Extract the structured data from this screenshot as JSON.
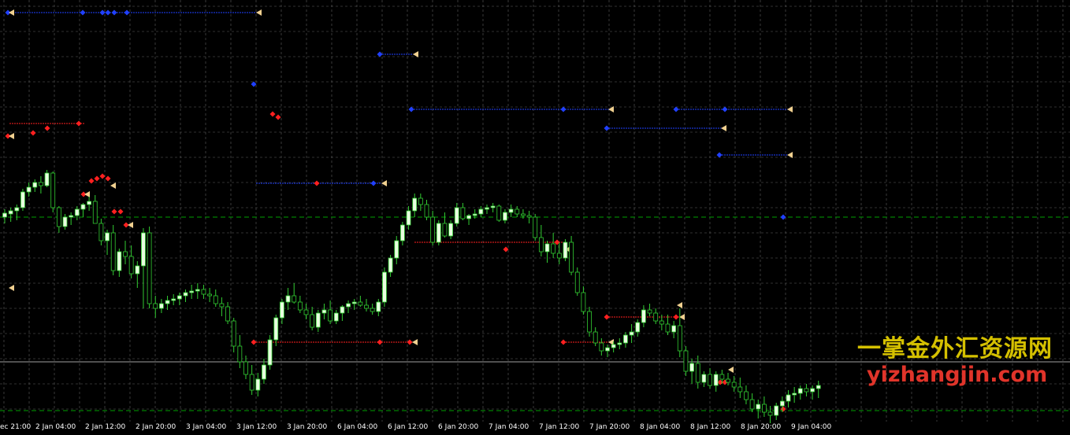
{
  "chart_data": {
    "type": "candlestick",
    "title": "",
    "xlabel": "",
    "ylabel": "",
    "grid": true,
    "background": "#000000",
    "colors": {
      "grid": "#606060",
      "bull_body": "#e8ffe0",
      "bear_body": "#000000",
      "wick": "#32cd32",
      "level_line": "#00a000",
      "blue_marker": "#2040ff",
      "red_marker": "#ff2020",
      "tan_marker": "#f0d090",
      "bid_line": "#a0a0a0"
    },
    "time_labels": [
      "ec 21:00",
      "2 Jan 04:00",
      "2 Jan 12:00",
      "2 Jan 20:00",
      "3 Jan 04:00",
      "3 Jan 12:00",
      "3 Jan 20:00",
      "6 Jan 04:00",
      "6 Jan 12:00",
      "6 Jan 20:00",
      "7 Jan 04:00",
      "7 Jan 12:00",
      "7 Jan 20:00",
      "8 Jan 04:00",
      "8 Jan 12:00",
      "8 Jan 20:00",
      "9 Jan 04:00"
    ],
    "candles": [
      [
        0,
        0,
        10,
        -8,
        5
      ],
      [
        1,
        4,
        12,
        -6,
        8
      ],
      [
        2,
        8,
        16,
        -4,
        12
      ],
      [
        3,
        12,
        36,
        8,
        32
      ],
      [
        4,
        32,
        44,
        26,
        38
      ],
      [
        5,
        38,
        48,
        32,
        44
      ],
      [
        6,
        44,
        52,
        30,
        40
      ],
      [
        7,
        40,
        60,
        38,
        56
      ],
      [
        8,
        56,
        58,
        6,
        12
      ],
      [
        9,
        12,
        14,
        -20,
        -12
      ],
      [
        10,
        -12,
        4,
        -16,
        0
      ],
      [
        11,
        0,
        6,
        -10,
        2
      ],
      [
        12,
        2,
        14,
        -4,
        10
      ],
      [
        13,
        10,
        18,
        0,
        16
      ],
      [
        14,
        16,
        26,
        8,
        20
      ],
      [
        15,
        20,
        28,
        -4,
        -8
      ],
      [
        16,
        -8,
        -2,
        -36,
        -30
      ],
      [
        17,
        -30,
        -16,
        -48,
        -20
      ],
      [
        18,
        -20,
        -10,
        -74,
        -68
      ],
      [
        19,
        -68,
        -40,
        -76,
        -44
      ],
      [
        20,
        -44,
        -30,
        -60,
        -50
      ],
      [
        21,
        -50,
        -36,
        -78,
        -72
      ],
      [
        22,
        -72,
        -56,
        -90,
        -62
      ],
      [
        23,
        -62,
        -14,
        -116,
        -20
      ],
      [
        24,
        -20,
        -12,
        -116,
        -110
      ],
      [
        25,
        -110,
        -100,
        -128,
        -116
      ],
      [
        26,
        -116,
        -104,
        -122,
        -110
      ],
      [
        27,
        -110,
        -100,
        -118,
        -106
      ],
      [
        28,
        -106,
        -98,
        -112,
        -104
      ],
      [
        29,
        -104,
        -96,
        -112,
        -100
      ],
      [
        30,
        -100,
        -92,
        -108,
        -96
      ],
      [
        31,
        -96,
        -86,
        -104,
        -94
      ],
      [
        32,
        -94,
        -84,
        -104,
        -92
      ],
      [
        33,
        -92,
        -86,
        -104,
        -98
      ],
      [
        34,
        -98,
        -90,
        -108,
        -100
      ],
      [
        35,
        -100,
        -92,
        -114,
        -110
      ],
      [
        36,
        -110,
        -102,
        -126,
        -114
      ],
      [
        37,
        -114,
        -108,
        -136,
        -132
      ],
      [
        38,
        -132,
        -128,
        -172,
        -164
      ],
      [
        39,
        -164,
        -150,
        -192,
        -184
      ],
      [
        40,
        -184,
        -176,
        -206,
        -200
      ],
      [
        41,
        -200,
        -188,
        -226,
        -220
      ],
      [
        42,
        -220,
        -198,
        -228,
        -206
      ],
      [
        43,
        -206,
        -180,
        -212,
        -188
      ],
      [
        44,
        -188,
        -150,
        -194,
        -156
      ],
      [
        45,
        -156,
        -124,
        -164,
        -128
      ],
      [
        46,
        -128,
        -104,
        -136,
        -108
      ],
      [
        47,
        -108,
        -90,
        -118,
        -100
      ],
      [
        48,
        -100,
        -84,
        -110,
        -108
      ],
      [
        49,
        -108,
        -100,
        -122,
        -118
      ],
      [
        50,
        -118,
        -110,
        -130,
        -124
      ],
      [
        51,
        -124,
        -114,
        -144,
        -140
      ],
      [
        52,
        -140,
        -118,
        -146,
        -122
      ],
      [
        53,
        -122,
        -110,
        -130,
        -118
      ],
      [
        54,
        -118,
        -106,
        -136,
        -132
      ],
      [
        55,
        -132,
        -118,
        -136,
        -122
      ],
      [
        56,
        -122,
        -112,
        -132,
        -114
      ],
      [
        57,
        -114,
        -106,
        -122,
        -110
      ],
      [
        58,
        -110,
        -104,
        -118,
        -108
      ],
      [
        59,
        -108,
        -100,
        -114,
        -112
      ],
      [
        60,
        -112,
        -104,
        -120,
        -116
      ],
      [
        61,
        -116,
        -110,
        -124,
        -120
      ],
      [
        62,
        -120,
        -104,
        -126,
        -108
      ],
      [
        63,
        -108,
        -64,
        -114,
        -70
      ],
      [
        64,
        -70,
        -48,
        -76,
        -52
      ],
      [
        65,
        -52,
        -24,
        -60,
        -30
      ],
      [
        66,
        -30,
        -6,
        -36,
        -10
      ],
      [
        67,
        -10,
        14,
        -16,
        8
      ],
      [
        68,
        8,
        30,
        0,
        24
      ],
      [
        69,
        24,
        30,
        8,
        16
      ],
      [
        70,
        16,
        22,
        -4,
        0
      ],
      [
        71,
        0,
        8,
        -36,
        -32
      ],
      [
        72,
        -32,
        -4,
        -36,
        -8
      ],
      [
        73,
        -8,
        6,
        -26,
        -24
      ],
      [
        74,
        -24,
        -4,
        -28,
        -8
      ],
      [
        75,
        -8,
        18,
        -12,
        12
      ],
      [
        76,
        12,
        18,
        -4,
        -2
      ],
      [
        77,
        -2,
        4,
        -10,
        2
      ],
      [
        78,
        2,
        10,
        -2,
        4
      ],
      [
        79,
        4,
        14,
        0,
        10
      ],
      [
        80,
        10,
        16,
        4,
        12
      ],
      [
        81,
        12,
        18,
        6,
        14
      ],
      [
        82,
        14,
        16,
        -6,
        -4
      ],
      [
        83,
        -4,
        10,
        -8,
        6
      ],
      [
        84,
        6,
        16,
        0,
        10
      ],
      [
        85,
        10,
        14,
        0,
        4
      ],
      [
        86,
        4,
        10,
        -2,
        2
      ],
      [
        87,
        2,
        8,
        -8,
        0
      ],
      [
        88,
        0,
        4,
        -30,
        -26
      ],
      [
        89,
        -26,
        -10,
        -50,
        -44
      ],
      [
        90,
        -44,
        -30,
        -58,
        -34
      ],
      [
        91,
        -34,
        -20,
        -52,
        -46
      ],
      [
        92,
        -46,
        -32,
        -60,
        -52
      ],
      [
        93,
        -52,
        -28,
        -56,
        -32
      ],
      [
        94,
        -32,
        -24,
        -74,
        -70
      ],
      [
        95,
        -70,
        -64,
        -100,
        -96
      ],
      [
        96,
        -96,
        -88,
        -124,
        -120
      ],
      [
        97,
        -120,
        -114,
        -152,
        -146
      ],
      [
        98,
        -146,
        -140,
        -164,
        -160
      ],
      [
        99,
        -160,
        -154,
        -176,
        -170
      ],
      [
        100,
        -170,
        -162,
        -178,
        -166
      ],
      [
        101,
        -166,
        -158,
        -172,
        -162
      ],
      [
        102,
        -162,
        -154,
        -168,
        -160
      ],
      [
        103,
        -160,
        -146,
        -166,
        -150
      ],
      [
        104,
        -150,
        -136,
        -160,
        -146
      ],
      [
        105,
        -146,
        -130,
        -152,
        -134
      ],
      [
        106,
        -134,
        -112,
        -140,
        -118
      ],
      [
        107,
        -118,
        -110,
        -126,
        -122
      ],
      [
        108,
        -122,
        -116,
        -136,
        -132
      ],
      [
        109,
        -132,
        -124,
        -144,
        -136
      ],
      [
        110,
        -136,
        -124,
        -150,
        -146
      ],
      [
        111,
        -146,
        -132,
        -154,
        -138
      ],
      [
        112,
        -138,
        -116,
        -178,
        -170
      ],
      [
        113,
        -170,
        -164,
        -202,
        -196
      ],
      [
        114,
        -196,
        -180,
        -212,
        -186
      ],
      [
        115,
        -186,
        -176,
        -218,
        -210
      ],
      [
        116,
        -210,
        -196,
        -216,
        -200
      ],
      [
        117,
        -200,
        -192,
        -218,
        -214
      ],
      [
        118,
        -214,
        -196,
        -222,
        -200
      ],
      [
        119,
        -200,
        -194,
        -212,
        -206
      ],
      [
        120,
        -206,
        -198,
        -214,
        -210
      ],
      [
        121,
        -210,
        -202,
        -222,
        -216
      ],
      [
        122,
        -216,
        -204,
        -230,
        -222
      ],
      [
        123,
        -222,
        -214,
        -238,
        -232
      ],
      [
        124,
        -232,
        -224,
        -248,
        -244
      ],
      [
        125,
        -244,
        -232,
        -256,
        -238
      ],
      [
        126,
        -238,
        -228,
        -254,
        -248
      ],
      [
        127,
        -248,
        -240,
        -262,
        -252
      ],
      [
        128,
        -252,
        -236,
        -258,
        -240
      ],
      [
        129,
        -240,
        -228,
        -248,
        -234
      ],
      [
        130,
        -234,
        -220,
        -242,
        -226
      ],
      [
        131,
        -226,
        -216,
        -236,
        -224
      ],
      [
        132,
        -224,
        -214,
        -232,
        -218
      ],
      [
        133,
        -218,
        -212,
        -228,
        -222
      ],
      [
        134,
        -222,
        -214,
        -232,
        -218
      ],
      [
        135,
        -218,
        -208,
        -230,
        -214
      ]
    ],
    "horizontal_levels": [
      {
        "value": 0,
        "style": "dashed",
        "color": "#00a000"
      },
      {
        "value": -184,
        "style": "solid",
        "color": "#a0a0a0"
      },
      {
        "value": -246,
        "style": "dashed",
        "color": "#00a000"
      }
    ]
  },
  "watermark": {
    "chinese": "一掌金外汇资源网",
    "url": "yizhangjin.com"
  }
}
